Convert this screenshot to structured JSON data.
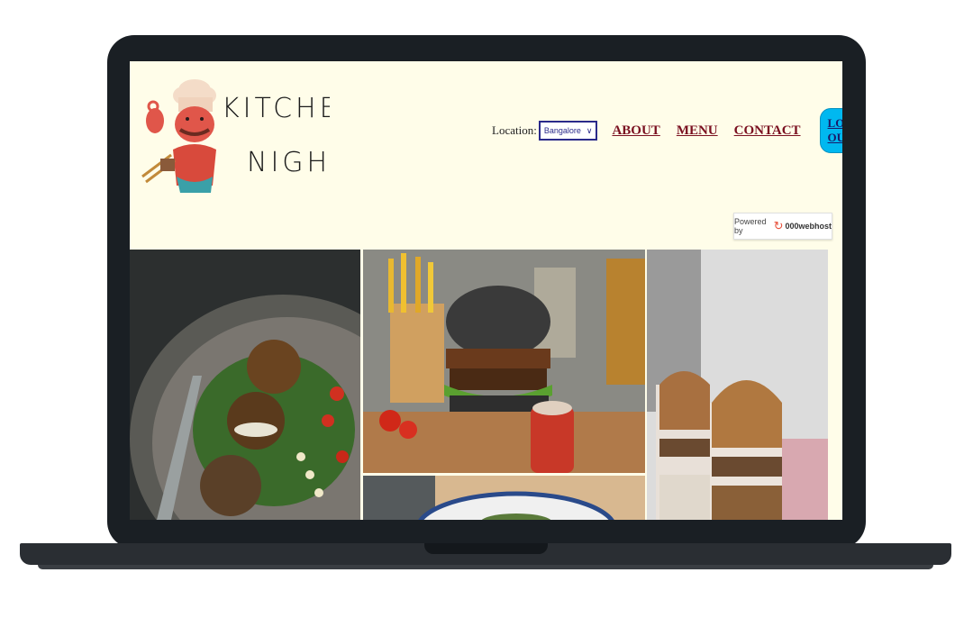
{
  "logo": {
    "line1": "KITCHEN",
    "line2": "NIGHT"
  },
  "location": {
    "label": "Location:",
    "selected": "Bangalore"
  },
  "nav": {
    "about": "ABOUT",
    "menu": "MENU",
    "contact": "CONTACT",
    "logout": "LOG OUT"
  },
  "powered": {
    "prefix": "Powered by",
    "brand": "000webhost"
  },
  "gallery": {
    "images": [
      "falafel-salad-image",
      "burger-fries-image",
      "nut-parfait-image",
      "bowl-image"
    ]
  }
}
